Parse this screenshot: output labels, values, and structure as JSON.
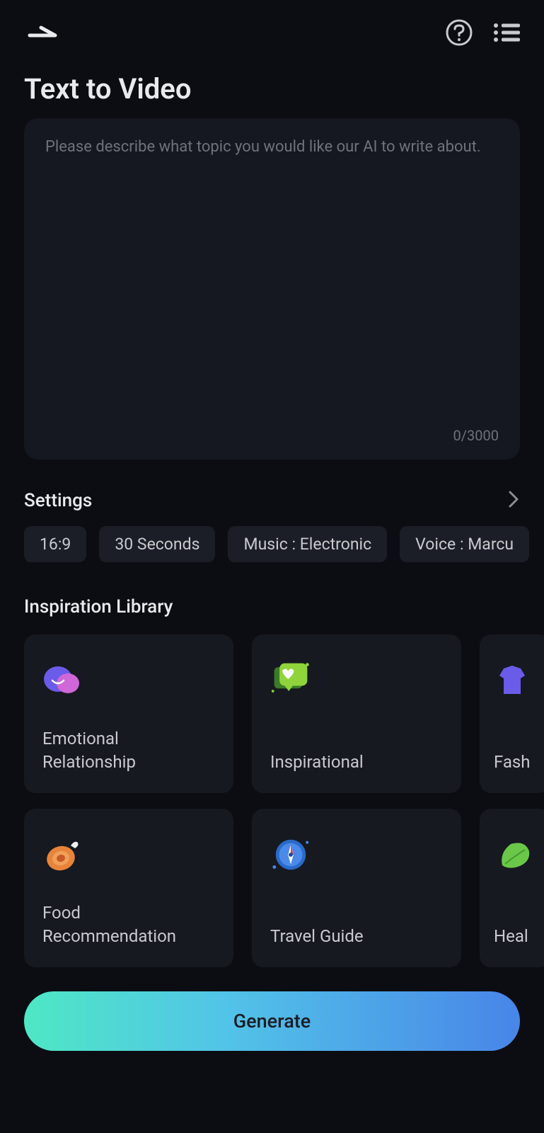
{
  "page_title": "Text to Video",
  "textarea": {
    "placeholder": "Please describe what topic you would like our AI to write about.",
    "value": "",
    "char_count": "0/3000"
  },
  "settings": {
    "title": "Settings",
    "chips": [
      "16:9",
      "30 Seconds",
      "Music : Electronic",
      "Voice : Marcu"
    ]
  },
  "inspiration": {
    "title": "Inspiration Library",
    "cards": [
      {
        "label": "Emotional Relationship",
        "icon": "emotion"
      },
      {
        "label": "Inspirational",
        "icon": "heart-chat"
      },
      {
        "label": "Fash",
        "icon": "fashion"
      },
      {
        "label": "Food Recommendation",
        "icon": "food"
      },
      {
        "label": "Travel Guide",
        "icon": "compass"
      },
      {
        "label": "Heal",
        "icon": "leaf"
      }
    ]
  },
  "generate_label": "Generate"
}
